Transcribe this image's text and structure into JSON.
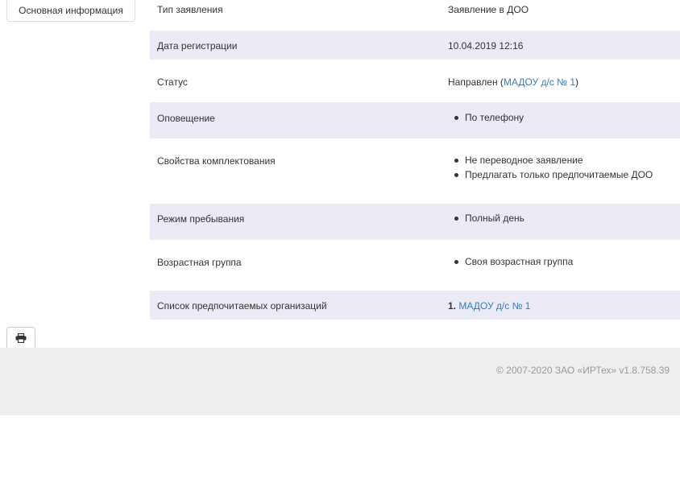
{
  "tabs": {
    "main_info": "Основная информация"
  },
  "details": {
    "type_label": "Тип заявления",
    "type_value": "Заявление в ДОО",
    "reg_date_label": "Дата регистрации",
    "reg_date_value": "10.04.2019 12:16",
    "status_label": "Статус",
    "status_prefix": "Направлен (",
    "status_link": "МАДОУ д/с № 1",
    "status_suffix": ")",
    "notification_label": "Оповещение",
    "notification_items": [
      "По телефону"
    ],
    "properties_label": "Свойства комплектования",
    "properties_items": [
      "Не переводное заявление",
      "Предлагать только предпочитаемые ДОО"
    ],
    "stay_mode_label": "Режим пребывания",
    "stay_mode_items": [
      "Полный день"
    ],
    "age_group_label": "Возрастная группа",
    "age_group_items": [
      "Своя возрастная группа"
    ],
    "preferred_label": "Список предпочитаемых организаций",
    "preferred_number": "1.",
    "preferred_link": "МАДОУ д/с № 1"
  },
  "footer": {
    "copyright": "© 2007-2020 ЗАО «ИРТех» v1.8.758.39"
  },
  "icons": {
    "print": "printer-icon"
  }
}
